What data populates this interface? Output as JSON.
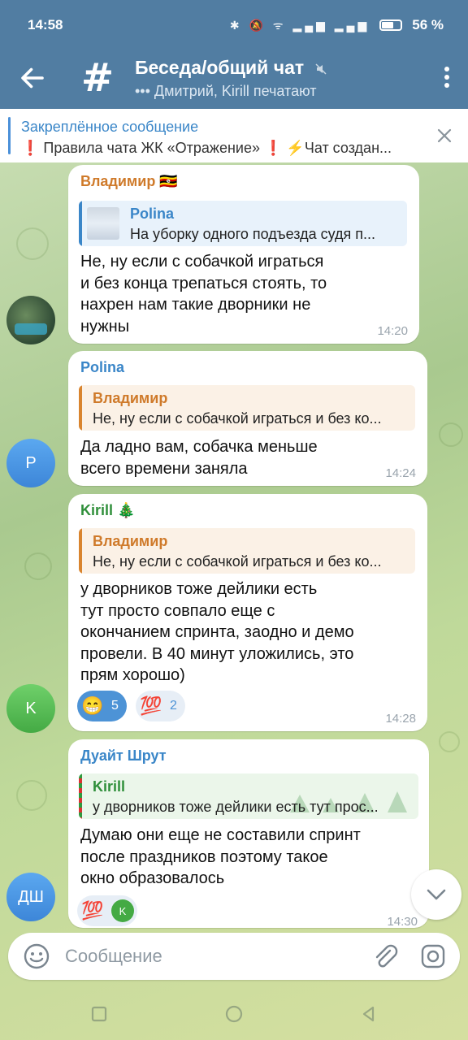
{
  "status_bar": {
    "time": "14:58",
    "battery": "56 %"
  },
  "header": {
    "title": "Беседа/общий чат",
    "typing": "••• Дмитрий, Kirill печатают"
  },
  "pinned": {
    "title": "Закреплённое сообщение",
    "text": "❗ Правила чата ЖК «Отражение» ❗ ⚡Чат создан..."
  },
  "messages": [
    {
      "sender": "Владимир",
      "sender_emoji": "🇺🇬",
      "sender_color": "#cf7a2a",
      "reply_name": "Polina",
      "reply_text": "На уборку одного подъезда судя п...",
      "lines": [
        "Не, ну если с собачкой играться",
        "и без конца трепаться стоять, то",
        "нахрен нам такие дворники не",
        "нужны"
      ],
      "time": "14:20"
    },
    {
      "sender": "Polina",
      "sender_color": "#3a86c8",
      "avatar": "P",
      "reply_name": "Владимир",
      "reply_text": "Не, ну если с собачкой играться и без ко...",
      "lines": [
        "Да ладно вам, собачка меньше",
        "всего времени заняла"
      ],
      "time": "14:24"
    },
    {
      "sender": "Kirill",
      "sender_emoji": "🎄",
      "sender_color": "#2f8f3a",
      "avatar": "K",
      "reply_name": "Владимир",
      "reply_text": "Не, ну если с собачкой играться и без ко...",
      "lines": [
        "у дворников тоже дейлики есть",
        "тут просто совпало еще с",
        "окончанием спринта, заодно и демо",
        "провели. В 40 минут уложились, это",
        "прям хорошо)"
      ],
      "reactions": [
        {
          "emoji": "😁",
          "count": "5"
        },
        {
          "emoji": "💯",
          "count": "2"
        }
      ],
      "time": "14:28"
    },
    {
      "sender": "Дуайт Шрут",
      "sender_color": "#3a86c8",
      "avatar": "ДШ",
      "reply_name": "Kirill",
      "reply_text": "у дворников тоже дейлики есть тут прос...",
      "lines": [
        "Думаю они еще не составили спринт",
        "после праздников поэтому такое",
        "окно образовалось"
      ],
      "reaction_emoji": "💯",
      "reaction_avatar": "K",
      "time": "14:30"
    }
  ],
  "input": {
    "placeholder": "Сообщение"
  }
}
